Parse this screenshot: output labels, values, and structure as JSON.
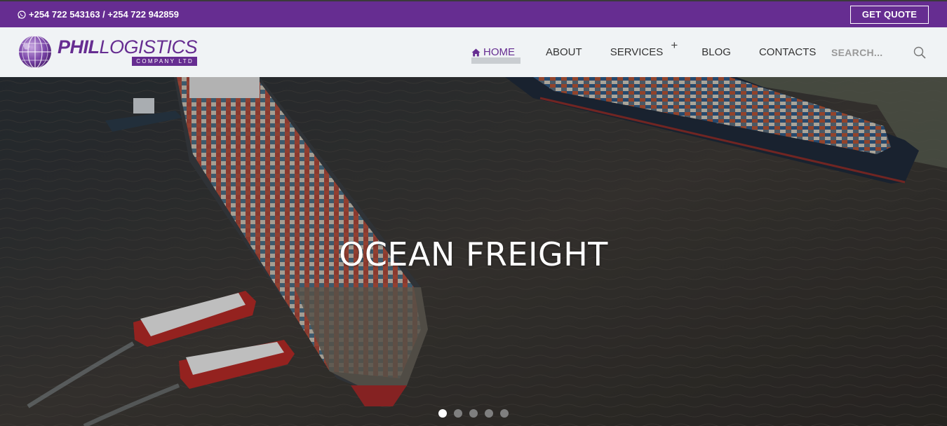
{
  "topbar": {
    "phone_text": "+254 722 543163 / +254 722 942859",
    "quote_button": "GET QUOTE",
    "bg_color": "#662d91"
  },
  "logo": {
    "main_bold": "PHIL",
    "main_light": "LOGISTICS",
    "sub": "COMPANY LTD",
    "icon": "globe-icon"
  },
  "nav": {
    "items": [
      {
        "label": "HOME",
        "icon": "home-icon",
        "active": true
      },
      {
        "label": "ABOUT"
      },
      {
        "label": "SERVICES",
        "has_submenu": true,
        "submenu_icon": "+"
      },
      {
        "label": "BLOG"
      },
      {
        "label": "CONTACTS"
      }
    ],
    "search_placeholder": "SEARCH...",
    "search_icon": "search-icon"
  },
  "hero": {
    "title": "OCEAN FREIGHT",
    "slides_count": 5,
    "active_slide": 1
  }
}
